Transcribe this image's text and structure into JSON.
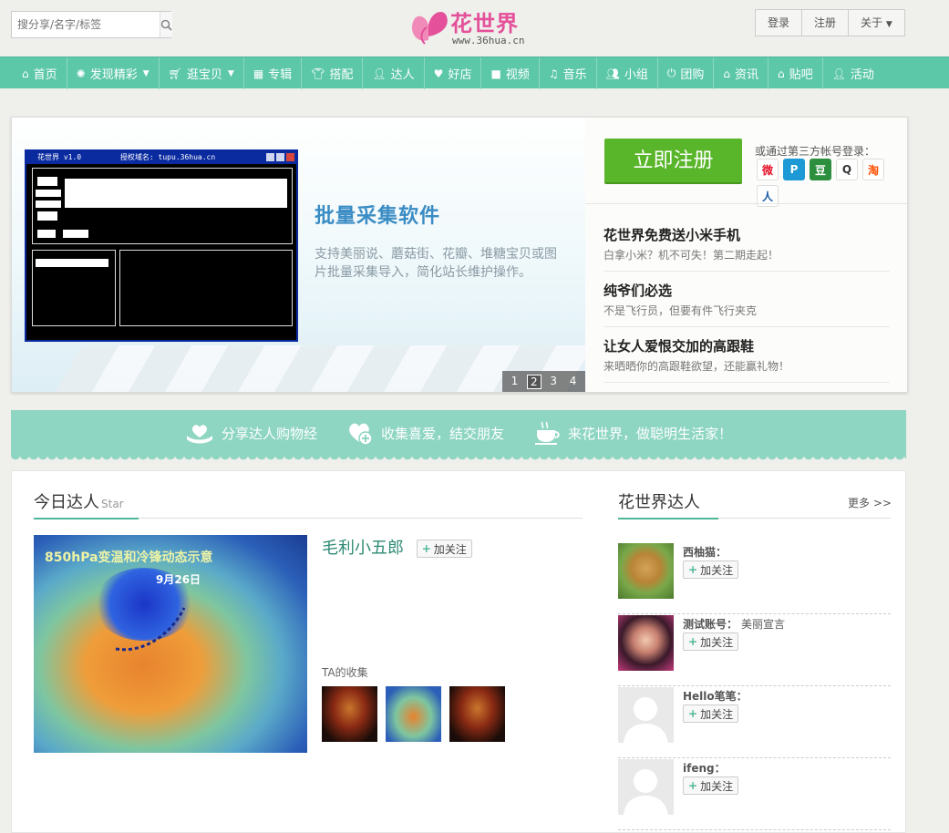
{
  "header": {
    "search_placeholder": "搜分享/名字/标签",
    "logo_name": "花世界",
    "logo_url": "www.36hua.cn",
    "top_links": [
      "登录",
      "注册",
      "关于"
    ]
  },
  "nav": [
    {
      "label": "首页",
      "icon": "home-icon"
    },
    {
      "label": "发现精彩",
      "icon": "compass-icon",
      "dropdown": true
    },
    {
      "label": "逛宝贝",
      "icon": "cart-icon",
      "dropdown": true
    },
    {
      "label": "专辑",
      "icon": "grid-icon"
    },
    {
      "label": "搭配",
      "icon": "shirt-icon"
    },
    {
      "label": "达人",
      "icon": "user-icon"
    },
    {
      "label": "好店",
      "icon": "heart-icon"
    },
    {
      "label": "视频",
      "icon": "video-icon"
    },
    {
      "label": "音乐",
      "icon": "music-icon"
    },
    {
      "label": "小组",
      "icon": "group-icon"
    },
    {
      "label": "团购",
      "icon": "power-icon"
    },
    {
      "label": "资讯",
      "icon": "home-icon"
    },
    {
      "label": "贴吧",
      "icon": "home-icon"
    },
    {
      "label": "活动",
      "icon": "user-plus-icon"
    }
  ],
  "hero": {
    "window_title": "花世界 v1.0",
    "window_domain": "授权域名: tupu.36hua.cn",
    "slide_title": "批量采集软件",
    "slide_desc": "支持美丽说、蘑菇街、花瓣、堆糖宝贝或图片批量采集导入，简化站长维护操作。",
    "pages": [
      "1",
      "2",
      "3",
      "4"
    ],
    "active_page": 2,
    "register_label": "立即注册",
    "third_party_label": "或通过第三方帐号登录：",
    "socials": [
      {
        "name": "weibo-icon",
        "glyph": "微",
        "color": "#e6162d"
      },
      {
        "name": "tencent-weibo-icon",
        "glyph": "P",
        "color": "#1d9ad6"
      },
      {
        "name": "douban-icon",
        "glyph": "豆",
        "color": "#2b8f3d"
      },
      {
        "name": "qq-icon",
        "glyph": "Q",
        "color": "#333333"
      },
      {
        "name": "taobao-icon",
        "glyph": "淘",
        "color": "#ff5000"
      },
      {
        "name": "renren-icon",
        "glyph": "人",
        "color": "#1f5ea8"
      }
    ],
    "news": [
      {
        "title": "花世界免费送小米手机",
        "desc": "白拿小米？机不可失！第二期走起！"
      },
      {
        "title": "纯爷们必选",
        "desc": "不是飞行员，但要有件飞行夹克"
      },
      {
        "title": "让女人爱恨交加的高跟鞋",
        "desc": "来晒晒你的高跟鞋欲望，还能赢礼物！"
      }
    ]
  },
  "banner": [
    {
      "label": "分享达人购物经",
      "icon": "hand-heart-icon"
    },
    {
      "label": "收集喜爱，结交朋友",
      "icon": "heart-plus-icon"
    },
    {
      "label": "来花世界，做聪明生活家！",
      "icon": "coffee-icon"
    }
  ],
  "today_star": {
    "title": "今日达人",
    "title_en": "Star",
    "image_caption": "850hPa变温和冷锋动态示意",
    "image_date": "9月26日",
    "username": "毛利小五郎",
    "follow_label": "加关注",
    "collection_label": "TA的收集"
  },
  "experts": {
    "title": "花世界达人",
    "more": "更多 >>",
    "people": [
      {
        "name": "西柚猫：",
        "extra": "",
        "avatar": "cat"
      },
      {
        "name": "测试账号：",
        "extra": "美丽宣言",
        "avatar": "girl"
      },
      {
        "name": "Hello笔笔：",
        "extra": "",
        "avatar": "empty"
      },
      {
        "name": "ifeng：",
        "extra": "",
        "avatar": "empty"
      }
    ],
    "follow_label": "加关注"
  }
}
